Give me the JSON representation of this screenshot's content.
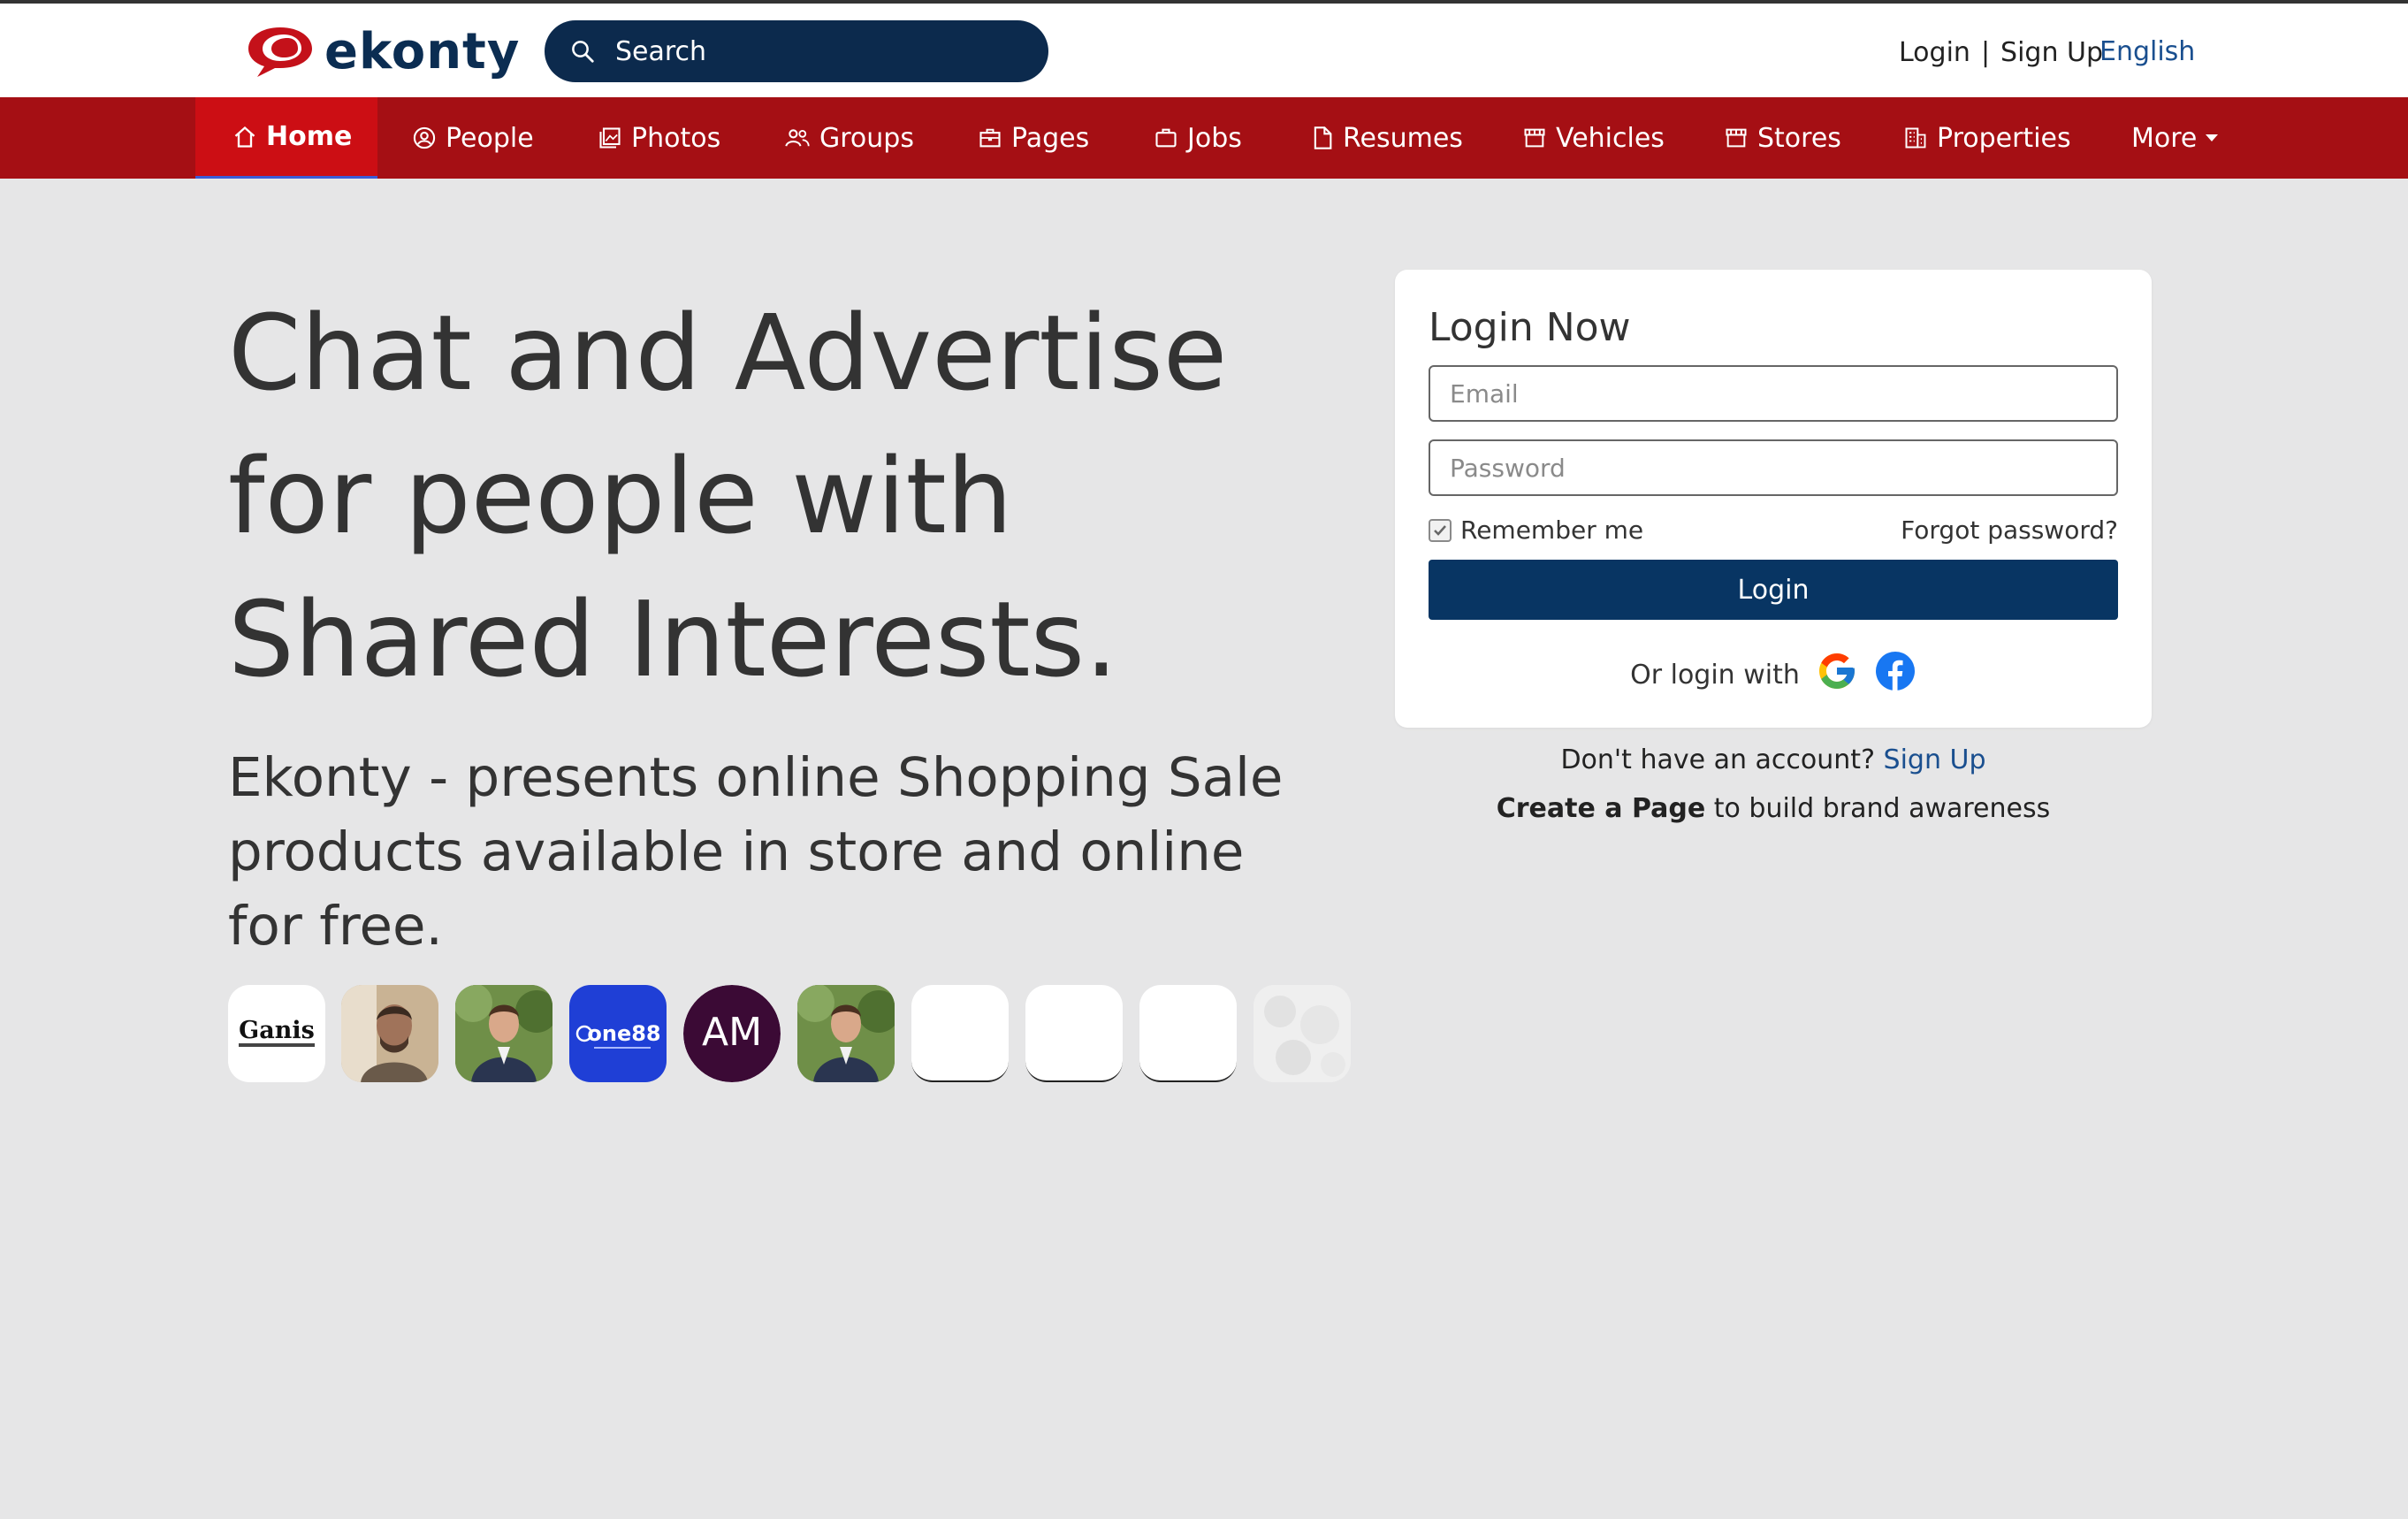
{
  "header": {
    "logo_text": "ekonty",
    "search_placeholder": "Search",
    "login": "Login",
    "separator": "|",
    "signup": "Sign Up",
    "language": "English"
  },
  "nav": {
    "items": [
      {
        "label": "Home",
        "icon": "home-icon"
      },
      {
        "label": "People",
        "icon": "user-circle-icon"
      },
      {
        "label": "Photos",
        "icon": "photos-icon"
      },
      {
        "label": "Groups",
        "icon": "users-icon"
      },
      {
        "label": "Pages",
        "icon": "briefcase-icon"
      },
      {
        "label": "Jobs",
        "icon": "bag-icon"
      },
      {
        "label": "Resumes",
        "icon": "document-icon"
      },
      {
        "label": "Vehicles",
        "icon": "store-icon"
      },
      {
        "label": "Stores",
        "icon": "store-icon"
      },
      {
        "label": "Properties",
        "icon": "building-icon"
      },
      {
        "label": "More",
        "icon": "caret-down-icon"
      }
    ]
  },
  "hero": {
    "title": "Chat and Advertise for people with Shared Interests.",
    "subtitle": "Ekonty - presents online Shopping Sale products available in store and online for free."
  },
  "avatars": {
    "items": [
      {
        "text": "Ganis"
      },
      {
        "text": ""
      },
      {
        "text": ""
      },
      {
        "text": "one88"
      },
      {
        "text": "AM"
      },
      {
        "text": ""
      },
      {
        "text": ""
      },
      {
        "text": ""
      },
      {
        "text": ""
      },
      {
        "text": ""
      }
    ]
  },
  "login": {
    "title": "Login Now",
    "email_placeholder": "Email",
    "password_placeholder": "Password",
    "remember": "Remember me",
    "forgot": "Forgot password?",
    "button": "Login",
    "or_login": "Or login with"
  },
  "footer": {
    "no_account": "Don't have an account?",
    "signup": "Sign Up",
    "create_page": "Create a Page",
    "create_rest": "to build brand awareness"
  },
  "colors": {
    "nav_bg": "#a50f14",
    "nav_active": "#cc0e14",
    "brand_navy": "#0b2d52",
    "button": "#083563",
    "link": "#1a4f8f"
  }
}
